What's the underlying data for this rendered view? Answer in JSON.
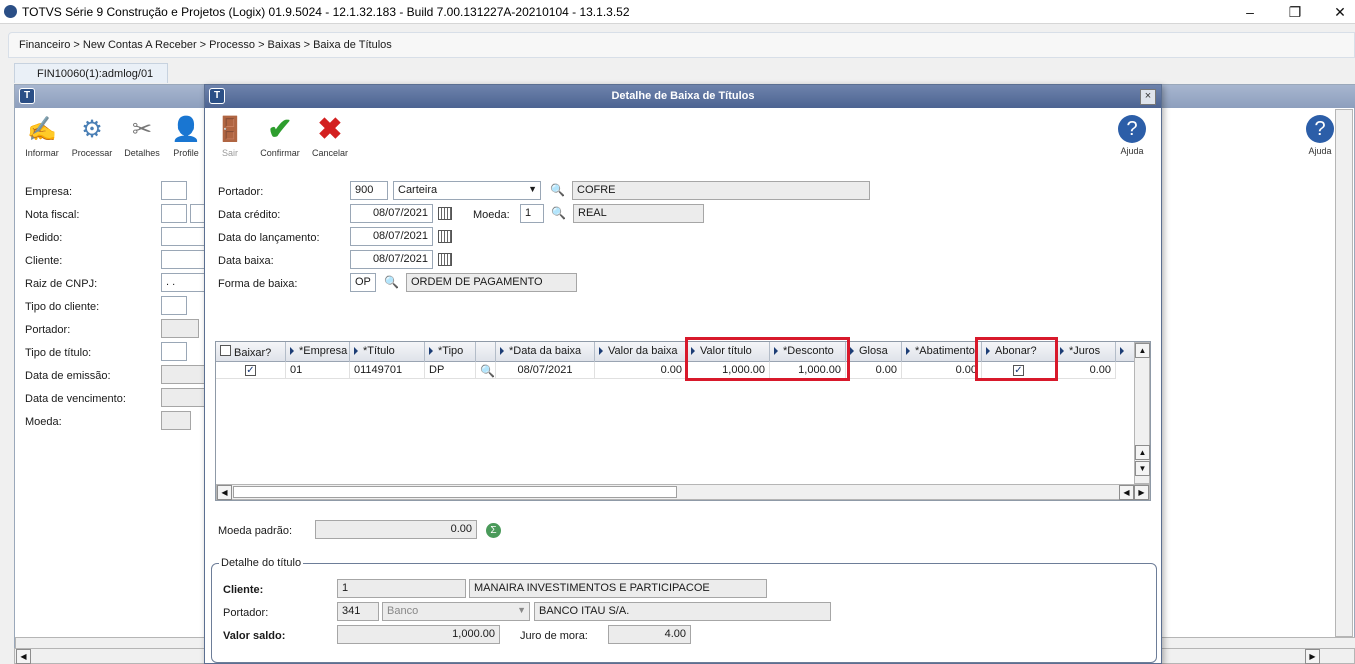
{
  "window": {
    "title": "TOTVS Série 9 Construção e Projetos (Logix) 01.9.5024 - 12.1.32.183 - Build 7.00.131227A-20210104 - 13.1.3.52"
  },
  "breadcrumb": "Financeiro > New Contas A Receber > Processo > Baixas > Baixa de Títulos",
  "tab": {
    "label": "FIN10060(1):admlog/01"
  },
  "background_toolbar": [
    {
      "label": "Informar",
      "icon": "pencil-paper-icon"
    },
    {
      "label": "Processar",
      "icon": "gears-icon"
    },
    {
      "label": "Detalhes",
      "icon": "tools-icon"
    },
    {
      "label": "Profile",
      "icon": "user-icon"
    }
  ],
  "background_help": {
    "label": "Ajuda",
    "icon": "help-icon"
  },
  "background_form": [
    "Empresa:",
    "Nota fiscal:",
    "Pedido:",
    "Cliente:",
    "Raiz de CNPJ:",
    "Tipo do cliente:",
    "Portador:",
    "Tipo de título:",
    "Data de emissão:",
    "Data de vencimento:",
    "Moeda:"
  ],
  "background_cnpj_value": ". .",
  "dialog": {
    "title": "Detalhe de Baixa de Títulos",
    "close": "×",
    "toolbar": {
      "sair": "Sair",
      "confirmar": "Confirmar",
      "cancelar": "Cancelar",
      "ajuda": "Ajuda"
    },
    "portador": {
      "label": "Portador:",
      "code": "900",
      "type": "Carteira",
      "name": "COFRE"
    },
    "data_credito": {
      "label": "Data crédito:",
      "value": "08/07/2021"
    },
    "moeda": {
      "label": "Moeda:",
      "code": "1",
      "name": "REAL"
    },
    "data_lancamento": {
      "label": "Data do lançamento:",
      "value": "08/07/2021"
    },
    "data_baixa": {
      "label": "Data baixa:",
      "value": "08/07/2021"
    },
    "forma_baixa": {
      "label": "Forma de  baixa:",
      "code": "OP",
      "name": "ORDEM DE PAGAMENTO"
    },
    "grid": {
      "columns": [
        "Baixar?",
        "*Empresa",
        "*Título",
        "*Tipo",
        "",
        "*Data da baixa",
        "Valor da baixa",
        "Valor título",
        "*Desconto",
        "Glosa",
        "*Abatimento",
        "Abonar?",
        "*Juros"
      ],
      "row": {
        "baixar": "✓",
        "empresa": "01",
        "titulo": "01149701",
        "tipo": "DP",
        "data_baixa": "08/07/2021",
        "valor_baixa": "0.00",
        "valor_titulo": "1,000.00",
        "desconto": "1,000.00",
        "glosa": "0.00",
        "abatimento": "0.00",
        "abonar": "✓",
        "juros": "0.00"
      }
    },
    "moeda_padrao": {
      "label": "Moeda padrão:",
      "value": "0.00"
    },
    "detalhe": {
      "legend": "Detalhe do título",
      "cliente": {
        "label": "Cliente:",
        "code": "1",
        "name": "MANAIRA INVESTIMENTOS E PARTICIPACOE"
      },
      "portador": {
        "label": "Portador:",
        "code": "341",
        "type": "Banco",
        "name": "BANCO ITAU S/A."
      },
      "valor_saldo": {
        "label": "Valor saldo:",
        "value": "1,000.00"
      },
      "juro_mora": {
        "label": "Juro de mora:",
        "value": "4.00"
      }
    }
  },
  "colors": {
    "accent": "#4c6391",
    "highlight": "#d8192b",
    "confirm": "#2e9e2e",
    "cancel": "#d32020"
  }
}
